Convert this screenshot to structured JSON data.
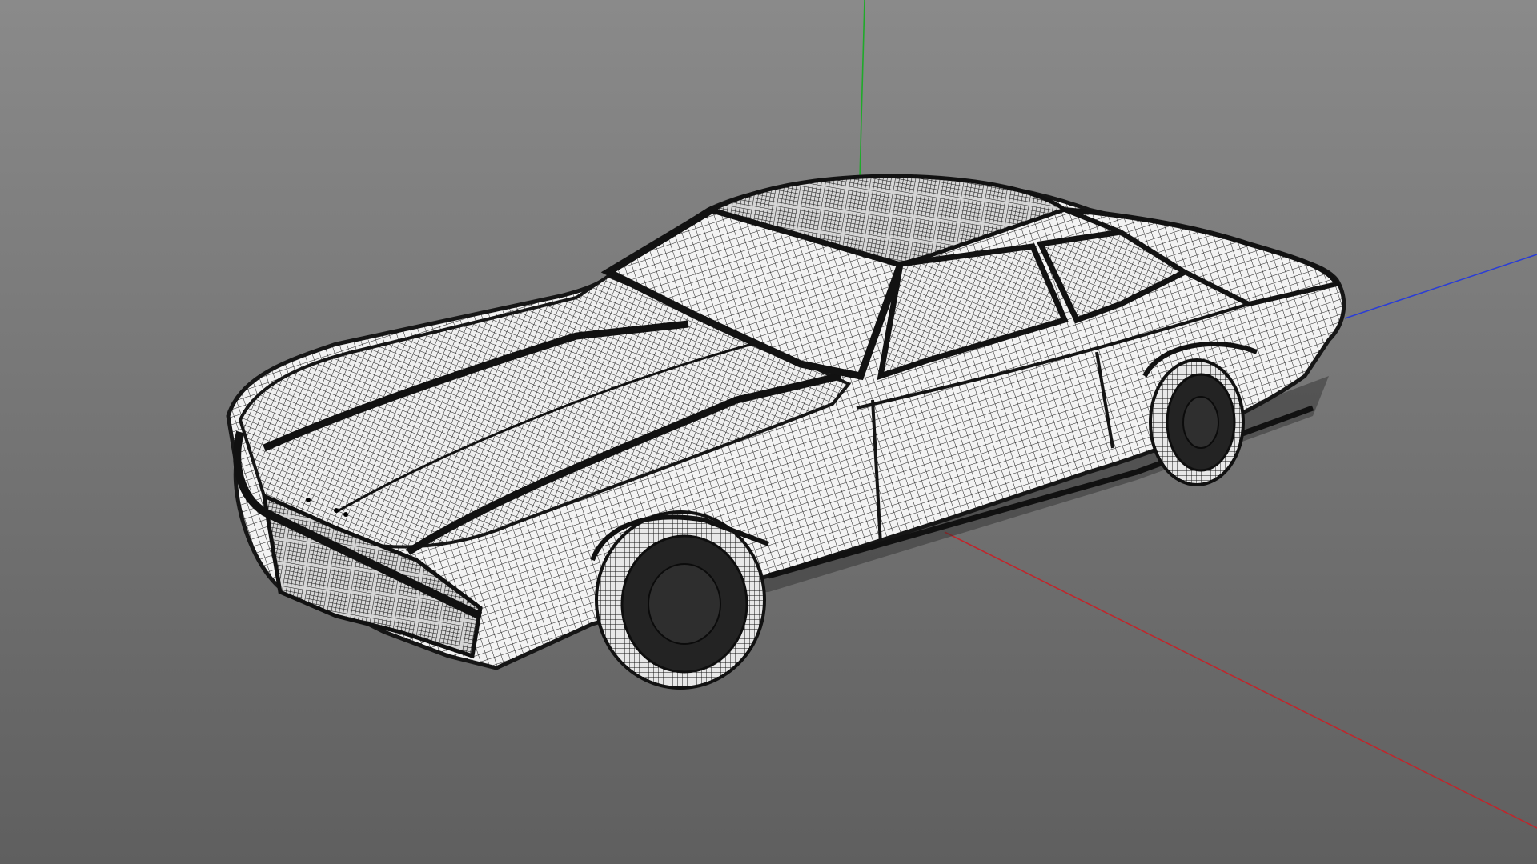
{
  "viewport": {
    "background_top": "#8a8a8a",
    "background_bottom": "#5f5f5f"
  },
  "axes": {
    "x_axis_color": "#c0262b",
    "y_axis_color": "#1faa2a",
    "z_axis_color": "#2a3dd6"
  },
  "model": {
    "render_mode": "wireframe",
    "body_fill": "#f2f2f2",
    "wire_color": "#1b1b1b",
    "tire_color": "#222222"
  }
}
